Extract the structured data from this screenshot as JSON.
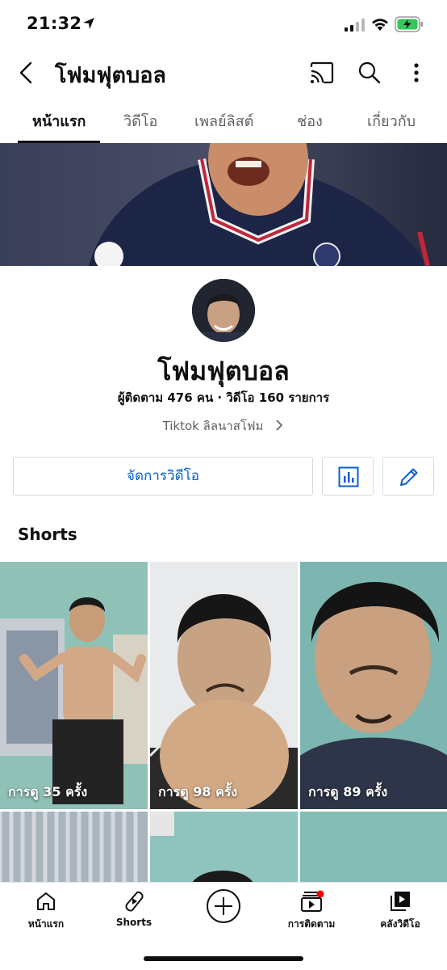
{
  "status_bar": {
    "time": "21:32",
    "icons": [
      "location-arrow-icon",
      "signal-icon",
      "wifi-icon",
      "battery-charging-icon"
    ]
  },
  "header": {
    "title": "โฟมฟุตบอล",
    "icons": [
      "back-icon",
      "cast-icon",
      "search-icon",
      "more-vert-icon"
    ]
  },
  "tabs": [
    {
      "label": "หน้าแรก",
      "active": true
    },
    {
      "label": "วิดีโอ",
      "active": false
    },
    {
      "label": "เพลย์ลิสต์",
      "active": false
    },
    {
      "label": "ช่อง",
      "active": false
    },
    {
      "label": "เกี่ยวกับ",
      "active": false
    }
  ],
  "channel": {
    "name": "โฟมฟุตบอล",
    "stats": "ผู้ติดตาม 476 คน · วิดีโอ 160 รายการ",
    "link": "Tiktok ลิลนาสโฟม"
  },
  "actions": {
    "manage_label": "จัดการวิดีโอ",
    "icons": [
      "analytics-icon",
      "edit-pencil-icon"
    ]
  },
  "shorts": {
    "heading": "Shorts",
    "items": [
      {
        "views": "การดู 35 ครั้ง"
      },
      {
        "views": "การดู 98 ครั้ง"
      },
      {
        "views": "การดู 89 ครั้ง"
      }
    ]
  },
  "bottom_nav": [
    {
      "label": "หน้าแรก",
      "icon": "home-icon"
    },
    {
      "label": "Shorts",
      "icon": "shorts-icon"
    },
    {
      "label": "",
      "icon": "create-plus-icon"
    },
    {
      "label": "การติดตาม",
      "icon": "subscriptions-icon"
    },
    {
      "label": "คลังวิดีโอ",
      "icon": "library-icon"
    }
  ],
  "colors": {
    "link_blue": "#065fd4",
    "text": "#0f0f0f",
    "secondary": "#606060",
    "notification_red": "#ff0000"
  }
}
